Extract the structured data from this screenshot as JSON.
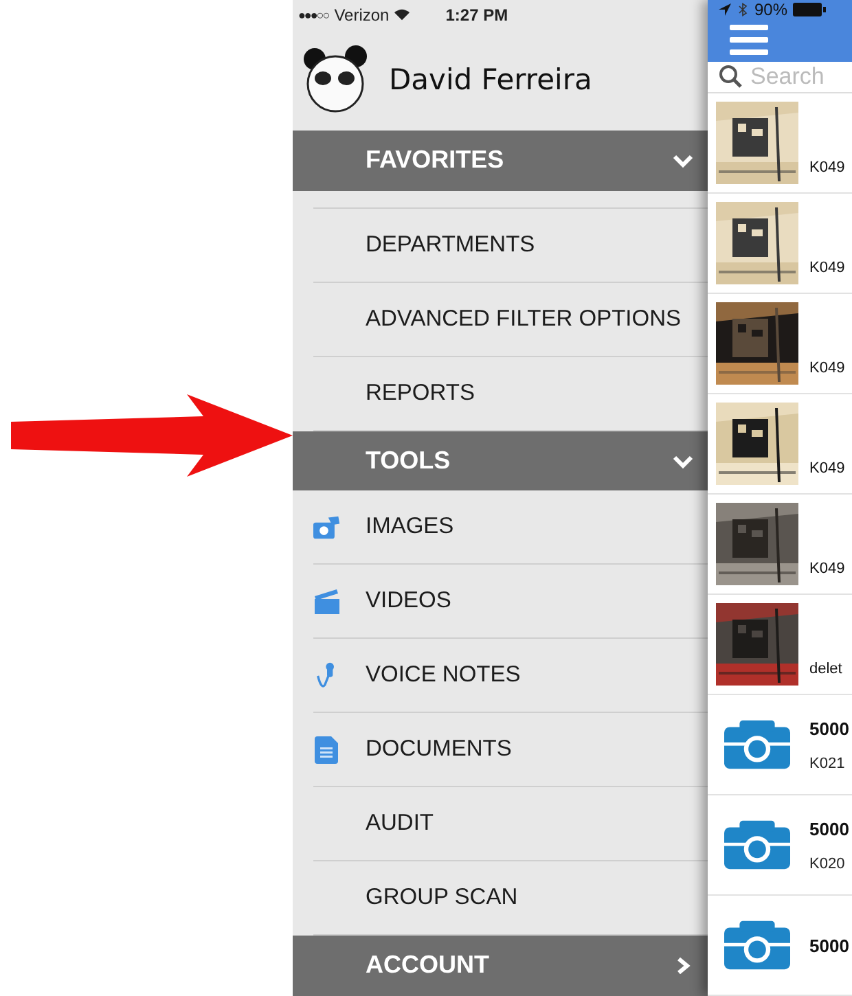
{
  "status_bar": {
    "signal": "●●●○○",
    "carrier": "Verizon",
    "time": "1:27 PM",
    "battery": "90%"
  },
  "drawer": {
    "user_name": "David Ferreira",
    "sections": [
      {
        "title": "FAVORITES",
        "expanded": true,
        "items": [
          {
            "kind": "blank"
          },
          {
            "kind": "plain",
            "label": "DEPARTMENTS"
          },
          {
            "kind": "plain",
            "label": "ADVANCED FILTER OPTIONS"
          },
          {
            "kind": "plain",
            "label": "REPORTS"
          }
        ]
      },
      {
        "title": "TOOLS",
        "expanded": true,
        "items": [
          {
            "kind": "camera",
            "label": "IMAGES"
          },
          {
            "kind": "clapper",
            "label": "VIDEOS"
          },
          {
            "kind": "microphone",
            "label": "VOICE NOTES"
          },
          {
            "kind": "document",
            "label": "DOCUMENTS"
          },
          {
            "kind": "plain",
            "label": "AUDIT"
          },
          {
            "kind": "plain",
            "label": "GROUP SCAN"
          }
        ]
      },
      {
        "title": "ACCOUNT",
        "expanded": false
      }
    ]
  },
  "main": {
    "search": {
      "placeholder": "Search"
    },
    "records": [
      {
        "title": "K049"
      },
      {
        "title": "K049"
      },
      {
        "title": "K049"
      },
      {
        "title": "K049"
      },
      {
        "title": "K049"
      },
      {
        "title": "delet"
      },
      {
        "kind": "camera",
        "title": "5000",
        "subtitle": "K021"
      },
      {
        "kind": "camera",
        "title": "5000",
        "subtitle": "K020"
      },
      {
        "kind": "camera",
        "title": "5000"
      }
    ]
  }
}
